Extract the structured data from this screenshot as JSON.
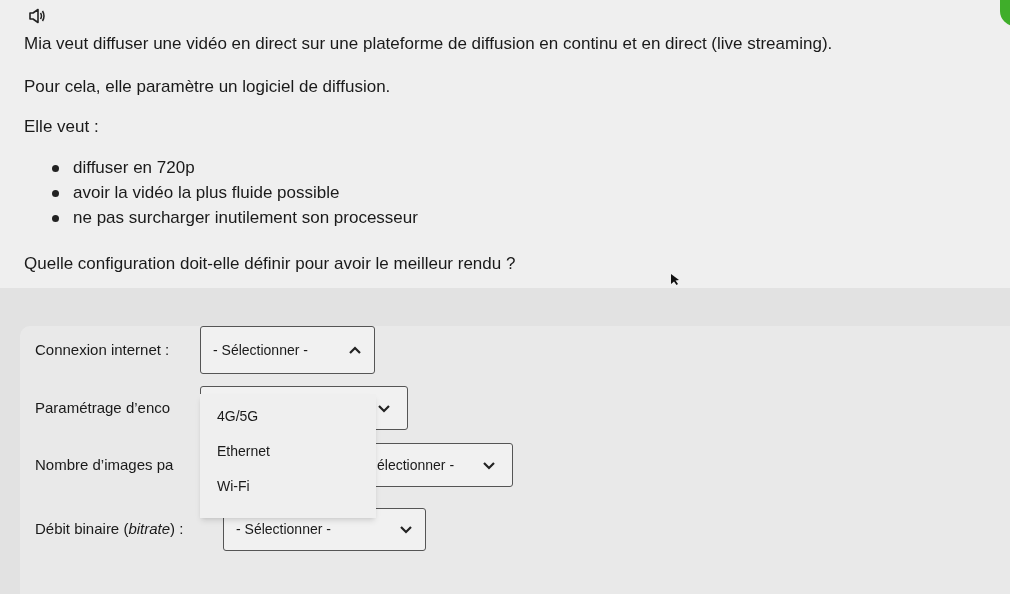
{
  "intro": [
    "Mia veut diffuser une vidéo en direct sur une plateforme de diffusion en continu et en direct (live streaming).",
    "Pour cela, elle paramètre un logiciel de diffusion.",
    "Elle veut :"
  ],
  "bullets": [
    "diffuser en 720p",
    "avoir la vidéo la plus fluide possible",
    "ne pas surcharger inutilement son processeur"
  ],
  "question": "Quelle configuration doit-elle définir pour avoir le meilleur rendu ?",
  "form": {
    "fields": [
      {
        "label": "Connexion internet :",
        "value": "- Sélectionner -",
        "open": true
      },
      {
        "label": "Paramétrage d’enco",
        "open": false
      },
      {
        "label": "Nombre d’images pa",
        "value": "électionner -",
        "open": false
      },
      {
        "label": "Débit binaire (*bitrate*) :",
        "value": "- Sélectionner -",
        "open": false
      }
    ],
    "menu": [
      "4G/5G",
      "Ethernet",
      "Wi-Fi"
    ]
  }
}
